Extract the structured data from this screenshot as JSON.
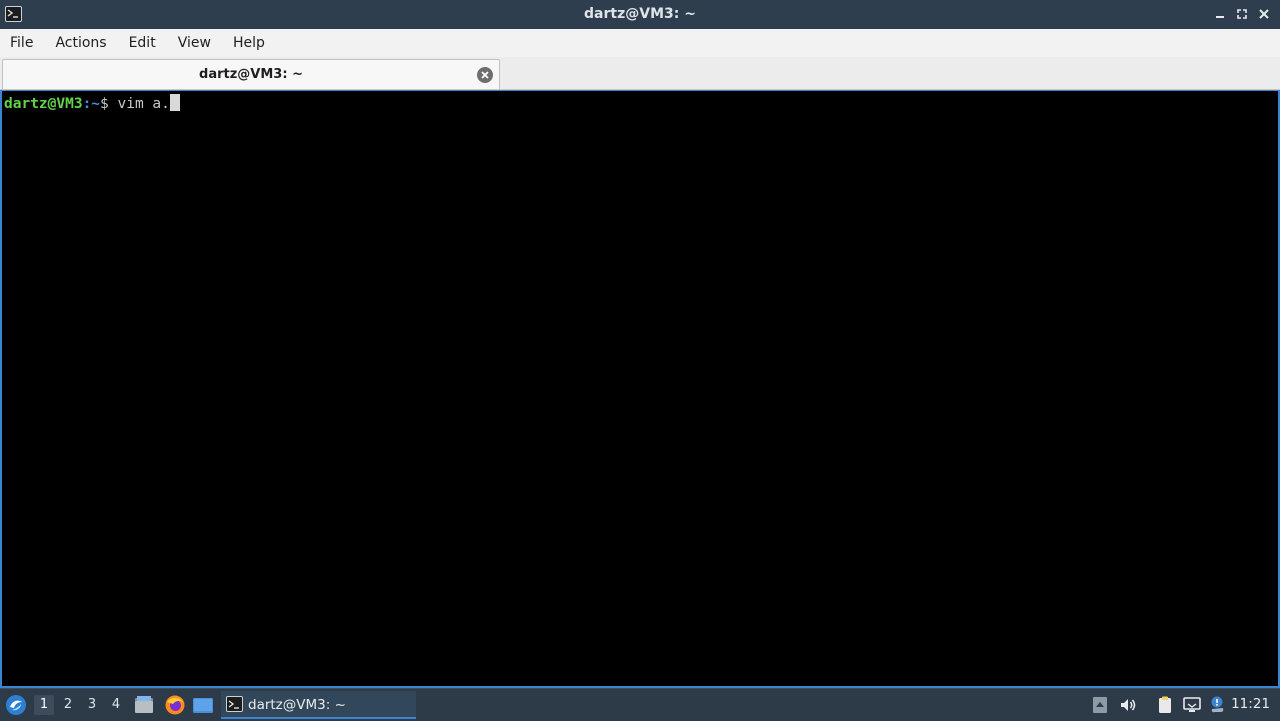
{
  "window": {
    "title": "dartz@VM3: ~",
    "controls": [
      "minimize",
      "maximize",
      "close"
    ]
  },
  "menubar": {
    "items": [
      {
        "label": "File"
      },
      {
        "label": "Actions"
      },
      {
        "label": "Edit"
      },
      {
        "label": "View"
      },
      {
        "label": "Help"
      }
    ]
  },
  "tabs": [
    {
      "label": "dartz@VM3: ~",
      "active": true
    }
  ],
  "terminal": {
    "prompt_user": "dartz@VM3",
    "prompt_path": ":~",
    "prompt_symbol": "$",
    "command": " vim a."
  },
  "taskbar": {
    "workspaces": [
      "1",
      "2",
      "3",
      "4"
    ],
    "active_workspace": "1",
    "launchers": [
      "file-manager-icon",
      "firefox-icon",
      "desktop-icon"
    ],
    "task_label": "dartz@VM3: ~",
    "tray_icons": [
      "tray-up-arrow-icon",
      "volume-icon",
      "clipboard-icon",
      "monitor-icon",
      "update-notifier-icon"
    ],
    "clock": "11:21"
  },
  "colors": {
    "titlebar_bg": "#2f3e4e",
    "terminal_bg": "#000000",
    "prompt_user": "#62d24a",
    "prompt_path": "#4c86e6",
    "accent": "#3b84d2",
    "taskbar_bg": "#2d3b49"
  }
}
